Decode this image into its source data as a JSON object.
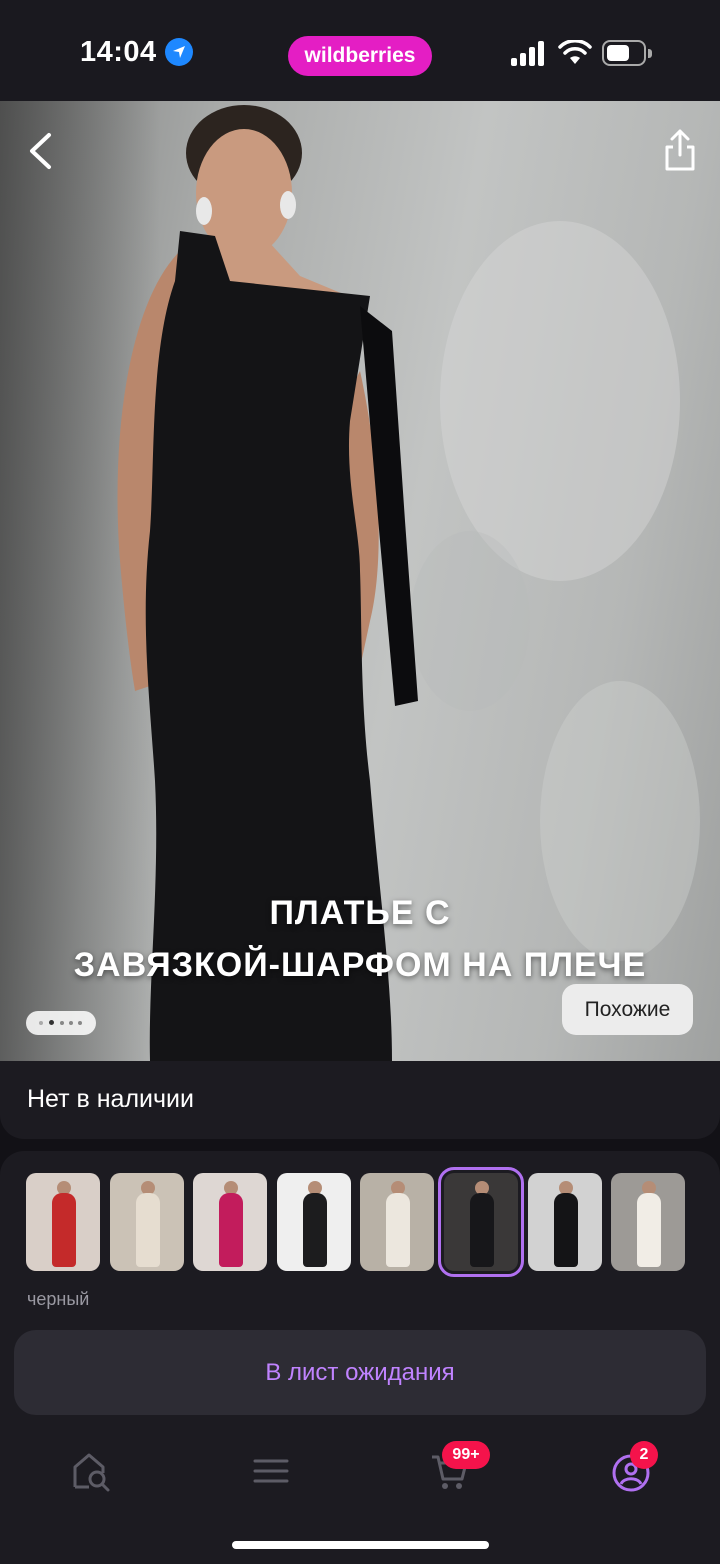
{
  "status_bar": {
    "time": "14:04",
    "brand": "wildberries",
    "icons": [
      "location-arrow-icon",
      "signal-icon",
      "wifi-icon",
      "battery-icon"
    ]
  },
  "hero": {
    "title_line1": "ПЛАТЬЕ С",
    "title_line2": "ЗАВЯЗКОЙ-ШАРФОМ НА ПЛЕЧЕ",
    "similar_label": "Похожие",
    "image_count": 5,
    "current_image": 2
  },
  "product": {
    "availability": "Нет в наличии",
    "selected_color": "черный"
  },
  "variants": [
    {
      "dress_color": "#c42a2a",
      "bg": "#d9cfc8"
    },
    {
      "dress_color": "#e6ddd0",
      "bg": "#cbc2b6"
    },
    {
      "dress_color": "#c21c5c",
      "bg": "#ded7d3"
    },
    {
      "dress_color": "#1c1c1e",
      "bg": "#efefef"
    },
    {
      "dress_color": "#ece7de",
      "bg": "#b8b1a6"
    },
    {
      "dress_color": "#17171a",
      "bg": "#3a3838"
    },
    {
      "dress_color": "#141416",
      "bg": "#d2d2d2"
    },
    {
      "dress_color": "#f1ede6",
      "bg": "#9d9a96"
    }
  ],
  "actions": {
    "waitlist_label": "В лист ожидания"
  },
  "nav": {
    "cart_badge": "99+",
    "profile_badge": "2"
  },
  "colors": {
    "brand": "#e41ec4",
    "accent": "#c083ff",
    "badge": "#f5134b"
  }
}
